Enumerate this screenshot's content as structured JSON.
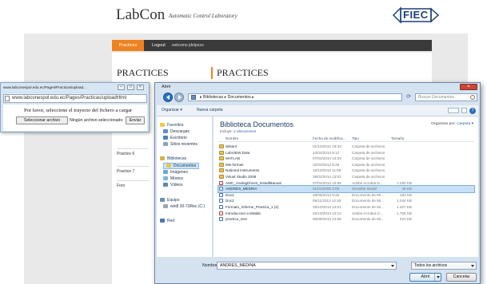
{
  "webpage": {
    "logo": "LabCon",
    "tagline": "Automatic Control Laboratory",
    "partner_logo": "FIEC",
    "nav": {
      "practices": "Practices",
      "logout": "Logout",
      "welcome": "welcome jdelpozo"
    },
    "heading_left": "PRACTICES",
    "heading_right": "PRACTICES",
    "side_items": [
      "Practice 6",
      "Practice 7",
      "Foro"
    ]
  },
  "upload_window": {
    "title": "www.labconespol.edu.ec/Pages/Practicas/upload...",
    "url": "www.labconespol.edu.ec/Pages/Practicas/uploadHtml",
    "message": "Por favor, seleccione el trayecto del fichero a cargar",
    "choose_button": "Seleccionar archivo",
    "status": "Ningún archivo seleccionado",
    "send_button": "Enviar"
  },
  "dialog": {
    "title": "Abrir",
    "path": "▸ Bibliotecas ▸ Documentos ▸",
    "search_placeholder": "Buscar Documentos",
    "toolbar": {
      "organize": "Organizar ▾",
      "new_folder": "Nueva carpeta"
    },
    "nav": {
      "favorites": {
        "label": "Favoritos",
        "items": [
          "Descargas",
          "Escritorio",
          "Sitios recientes"
        ]
      },
      "libraries": {
        "label": "Bibliotecas",
        "items": [
          "Documentos",
          "Imágenes",
          "Música",
          "Vídeos"
        ]
      },
      "computer": {
        "label": "Equipo",
        "items": [
          "win8 30-73Rec (C:)"
        ]
      },
      "network": {
        "label": "Red"
      }
    },
    "library_title": "Biblioteca Documentos",
    "library_sub_prefix": "Incluye:",
    "library_sub_link": "2 ubicaciones",
    "arrange_label": "Organizar por:",
    "arrange_value": "Carpeta ▾",
    "columns": {
      "name": "Nombre",
      "date": "Fecha de modifica...",
      "type": "Tipo",
      "size": "Tamaño"
    },
    "files": [
      {
        "name": "debar4",
        "date": "01/10/2012 18:33",
        "type": "Carpeta de archivos",
        "size": "",
        "icon": "folder"
      },
      {
        "name": "LabVIEW Data",
        "date": "14/02/2014 9:12",
        "type": "Carpeta de archivos",
        "size": "",
        "icon": "folder"
      },
      {
        "name": "MATLAB",
        "date": "07/02/2014 14:03",
        "type": "Carpeta de archivos",
        "size": "",
        "icon": "folder"
      },
      {
        "name": "Mis formas",
        "date": "22/02/2013 9:28",
        "type": "Carpeta de archivos",
        "size": "",
        "icon": "folder"
      },
      {
        "name": "National Instruments",
        "date": "16/10/2013 11:58",
        "type": "Carpeta de archivos",
        "size": "",
        "icon": "folder"
      },
      {
        "name": "Visual Studio 2008",
        "date": "28/02/2014 13:02",
        "type": "Carpeta de archivos",
        "size": "",
        "icon": "folder"
      },
      {
        "name": "AMC_AnalogDrives_InstallManual",
        "date": "07/04/2014 16:56",
        "type": "Adobe Acrobat D...",
        "size": "7.290 KB",
        "icon": "pdf"
      },
      {
        "name": "ANDRES_MEDINA",
        "date": "01/01/2005 2:05",
        "type": "Simulink Model",
        "size": "46 KB",
        "icon": "sim",
        "selected": true
      },
      {
        "name": "Doc2",
        "date": "28/05/2013 9:25",
        "type": "Documento de Mi...",
        "size": "183 KB",
        "icon": "doc"
      },
      {
        "name": "Doc2",
        "date": "05/11/2013 12:25",
        "type": "Documento de Mi...",
        "size": "1.044 KB",
        "icon": "doc"
      },
      {
        "name": "Formato_Informe_Practica_1 (4)",
        "date": "25/10/2013 13:21",
        "type": "Documento de Mi...",
        "size": "1.327 KB",
        "icon": "doc"
      },
      {
        "name": "Introduccion a Matlab",
        "date": "25/10/2013 13:12",
        "type": "Adobe Acrobat D...",
        "size": "1.706 KB",
        "icon": "pdf"
      },
      {
        "name": "practica_mec",
        "date": "06/08/2013 12:55",
        "type": "Documento de Mi...",
        "size": "310 KB",
        "icon": "doc"
      }
    ],
    "filename_label": "Nombre:",
    "filename_value": "ANDRES_MEDINA",
    "filetype": "Todos los archivos",
    "open_button": "Abrir",
    "cancel_button": "Cancelar"
  }
}
